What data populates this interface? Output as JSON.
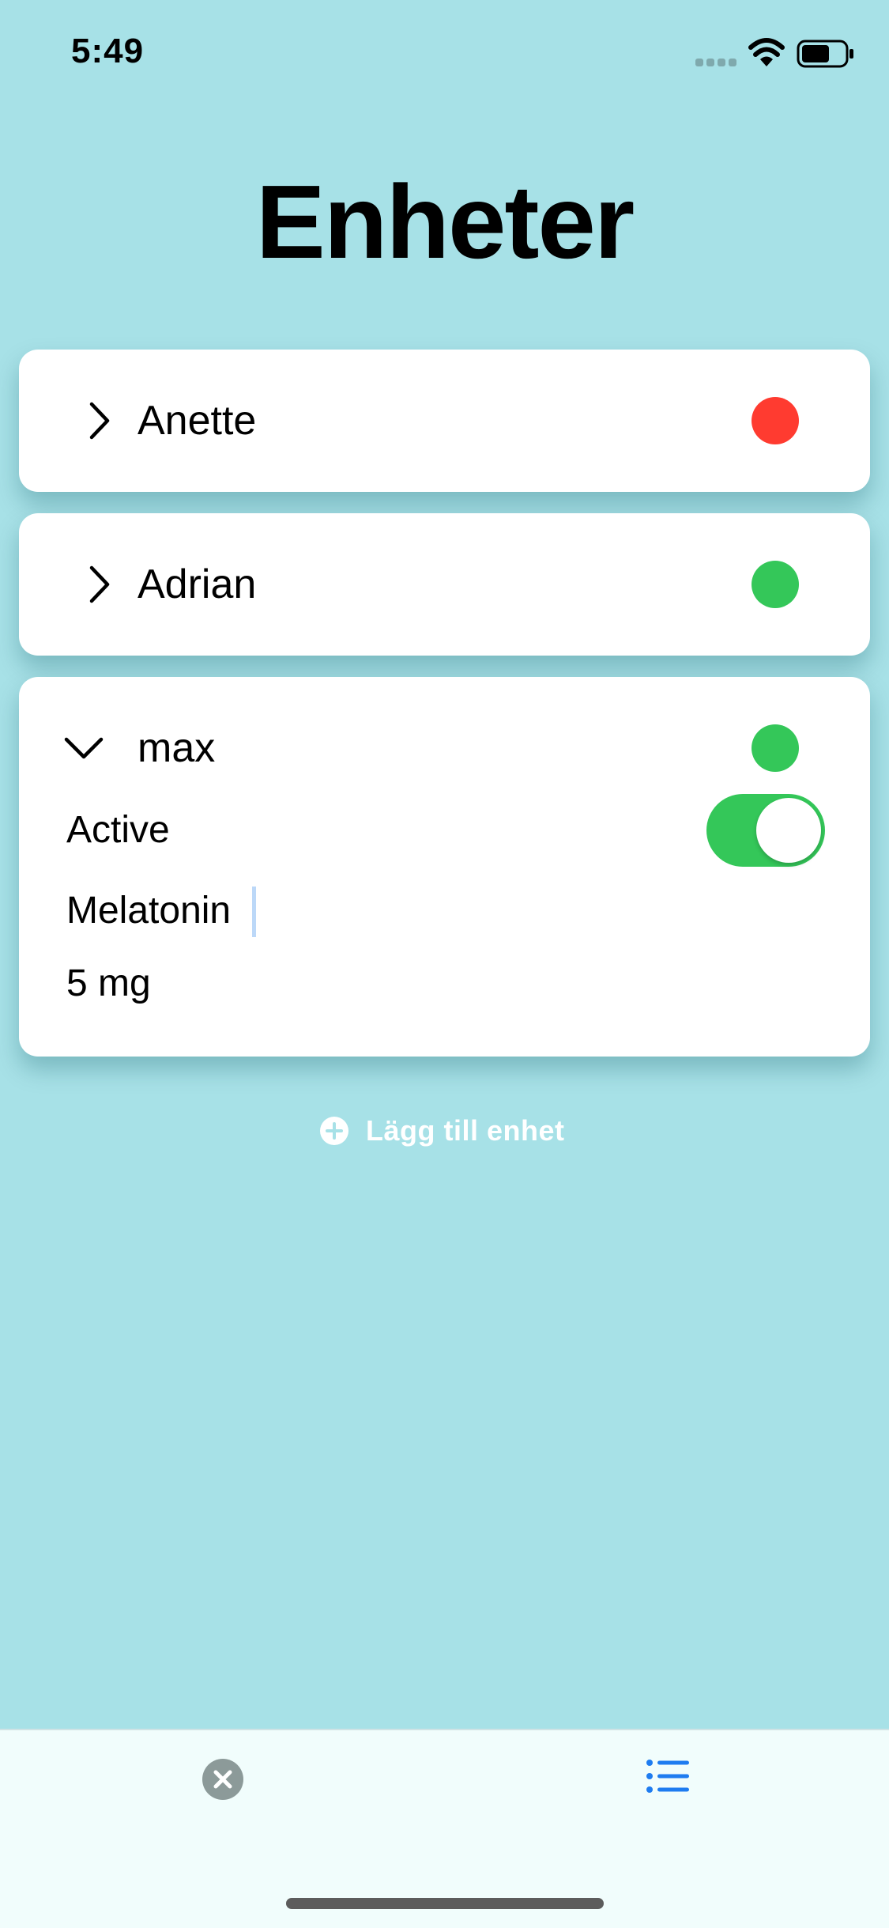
{
  "status_bar": {
    "time": "5:49"
  },
  "page": {
    "title": "Enheter"
  },
  "devices": [
    {
      "name": "Anette",
      "expanded": false,
      "status": "offline",
      "status_color": "#ff3b30"
    },
    {
      "name": "Adrian",
      "expanded": false,
      "status": "online",
      "status_color": "#34c759"
    },
    {
      "name": "max",
      "expanded": true,
      "status": "online",
      "status_color": "#34c759",
      "active_label": "Active",
      "active": true,
      "medication": "Melatonin",
      "dose": "5 mg"
    }
  ],
  "add_device": {
    "label": "Lägg till enhet",
    "icon": "plus-circle-icon"
  },
  "tab_bar": {
    "left_icon": "close-circle-icon",
    "right_icon": "list-icon",
    "accent": "#1e7cf0"
  },
  "colors": {
    "background": "#a7e1e7",
    "toggle_on": "#34c759"
  }
}
